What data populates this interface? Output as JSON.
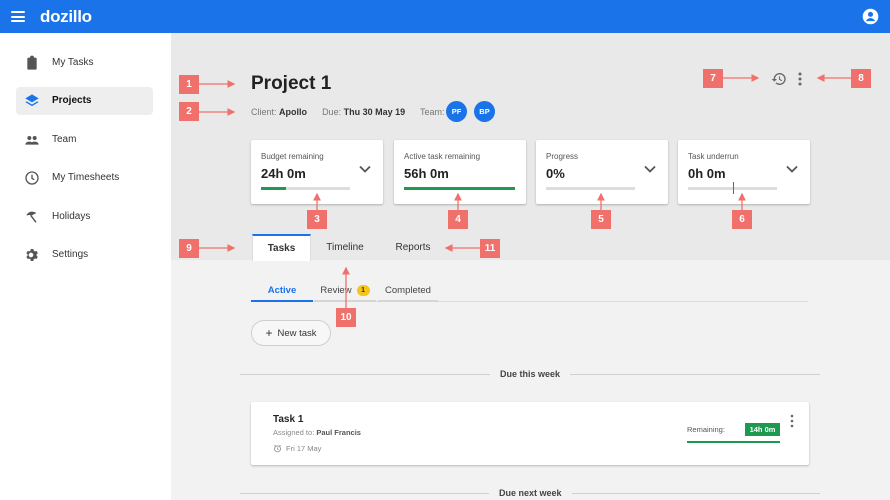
{
  "app": {
    "logo": "dozillo"
  },
  "sidebar": {
    "items": [
      {
        "label": "My Tasks",
        "icon": "clipboard-icon"
      },
      {
        "label": "Projects",
        "icon": "layers-icon",
        "active": true
      },
      {
        "label": "Team",
        "icon": "people-icon"
      },
      {
        "label": "My Timesheets",
        "icon": "clock-icon"
      },
      {
        "label": "Holidays",
        "icon": "beach-icon"
      },
      {
        "label": "Settings",
        "icon": "gear-icon"
      }
    ]
  },
  "project": {
    "title": "Project 1",
    "client_label": "Client:",
    "client": "Apollo",
    "due_label": "Due:",
    "due": "Thu 30 May 19",
    "team_label": "Team:",
    "team": [
      "PF",
      "BP"
    ]
  },
  "cards": [
    {
      "label": "Budget remaining",
      "value": "24h 0m",
      "progress": 0.28
    },
    {
      "label": "Active task remaining",
      "value": "56h 0m",
      "progress": 1.0
    },
    {
      "label": "Progress",
      "value": "0%",
      "progress": 0
    },
    {
      "label": "Task underrun",
      "value": "0h 0m",
      "marker": 0.5
    }
  ],
  "tabs": [
    "Tasks",
    "Timeline",
    "Reports"
  ],
  "subtabs": {
    "active": "Active",
    "review": "Review",
    "review_count": "1",
    "completed": "Completed"
  },
  "new_task": "New task",
  "sections": {
    "this_week": "Due this week",
    "next_week": "Due next week"
  },
  "task": {
    "title": "Task 1",
    "assigned_label": "Assigned to:",
    "assigned_to": "Paul Francis",
    "date": "Fri 17 May",
    "remaining_label": "Remaining:",
    "remaining": "14h 0m"
  },
  "annotations": [
    "1",
    "2",
    "3",
    "4",
    "5",
    "6",
    "7",
    "8",
    "9",
    "10",
    "11"
  ],
  "colors": {
    "brand": "#1a73e8",
    "success": "#1e9a50",
    "annotation": "#f0706b",
    "badge": "#f5c518"
  }
}
